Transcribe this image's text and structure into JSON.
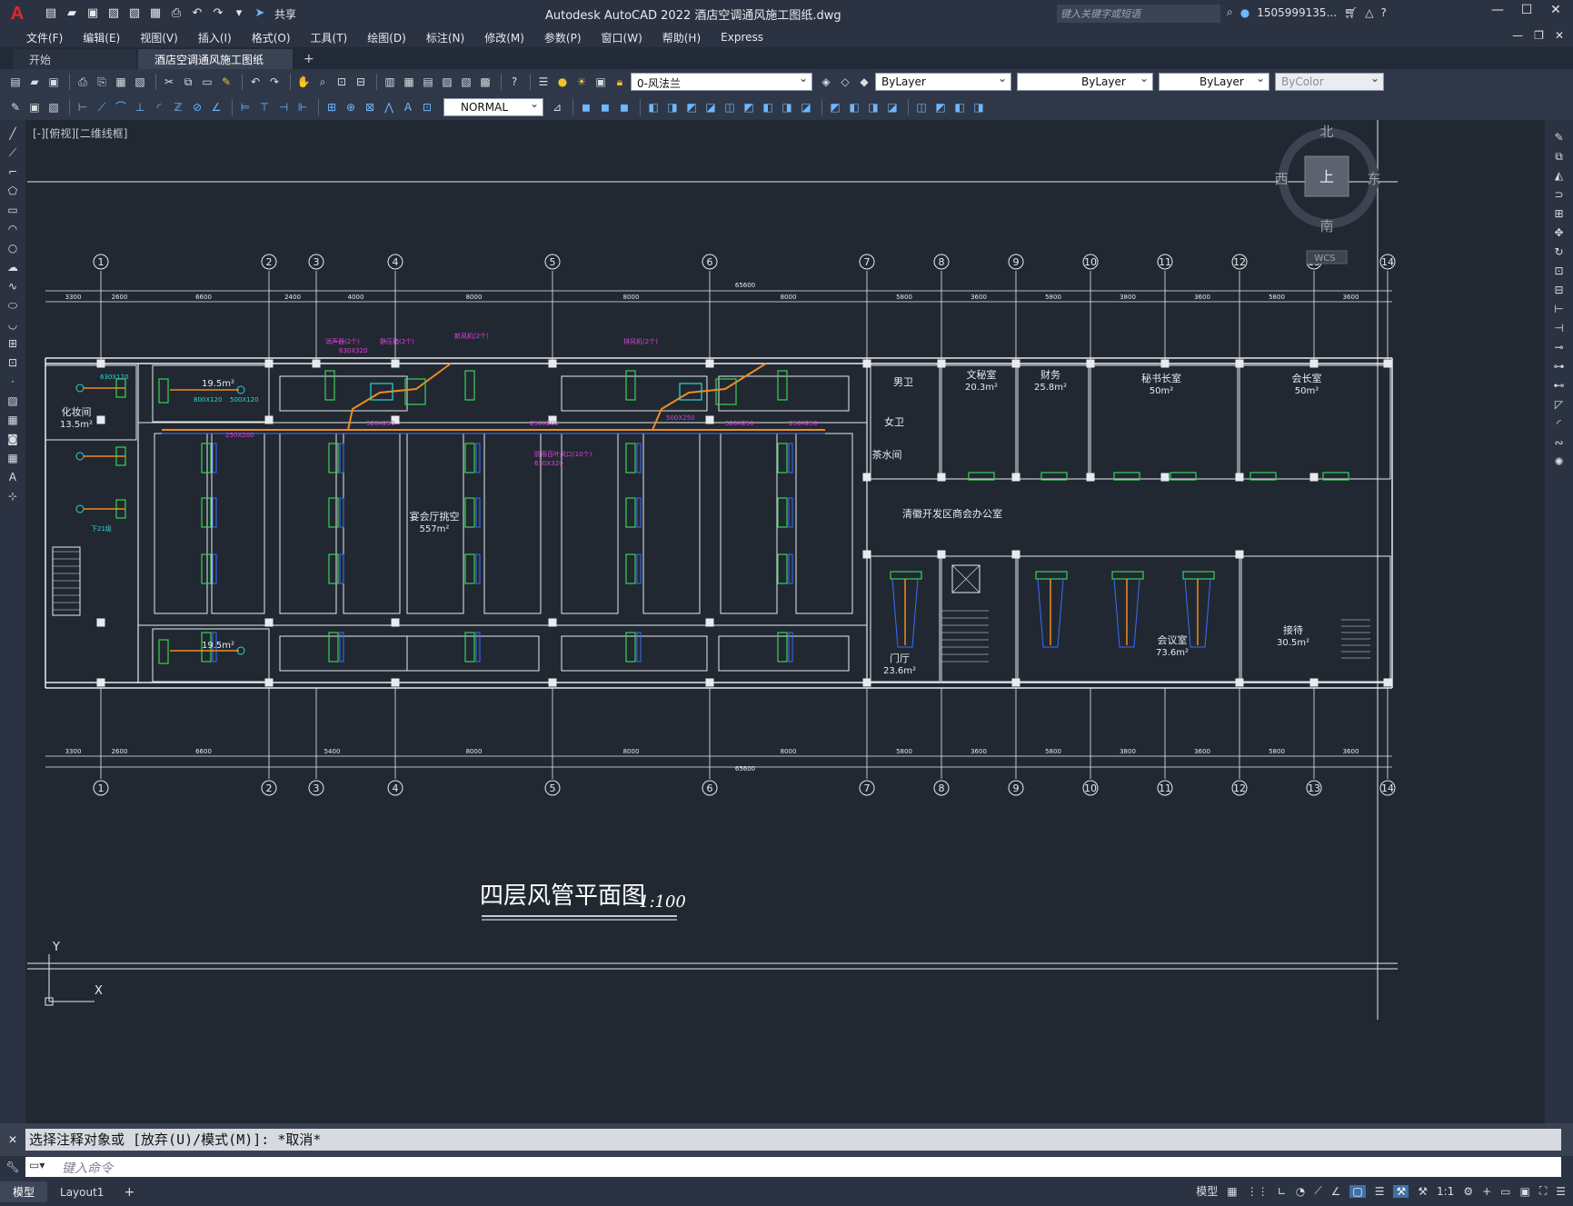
{
  "app": {
    "logo": "A",
    "title": "Autodesk AutoCAD 2022",
    "filename": "酒店空调通风施工图纸.dwg",
    "search_placeholder": "键入关键字或短语",
    "user": "1505999135...",
    "share": "共享",
    "help": "?"
  },
  "menu": [
    "文件(F)",
    "编辑(E)",
    "视图(V)",
    "插入(I)",
    "格式(O)",
    "工具(T)",
    "绘图(D)",
    "标注(N)",
    "修改(M)",
    "参数(P)",
    "窗口(W)",
    "帮助(H)",
    "Express"
  ],
  "tabs": {
    "start": "开始",
    "doc": "酒店空调通风施工图纸*",
    "close": "×",
    "add": "+"
  },
  "toolbar": {
    "layer": "0-风法兰",
    "color": "ByLayer",
    "linetype": "ByLayer",
    "lineweight": "ByLayer",
    "plotstyle": "ByColor",
    "dimstyle": "NORMAL"
  },
  "viewport": {
    "label": "[-][俯视][二维线框]",
    "compass": {
      "n": "北",
      "s": "南",
      "e": "东",
      "w": "西",
      "top": "上",
      "wcs": "WCS"
    }
  },
  "drawing": {
    "title": "四层风管平面图",
    "scale": "1:100",
    "axes_top": [
      "1",
      "2",
      "3",
      "4",
      "5",
      "6",
      "7",
      "8",
      "9",
      "10",
      "11",
      "12",
      "13",
      "14"
    ],
    "dims_top": [
      "3300",
      "2600",
      "6600",
      "2400",
      "4000",
      "8000",
      "8000",
      "8000",
      "5800",
      "3600",
      "5800",
      "3800",
      "3600",
      "5800",
      "3600"
    ],
    "total_dim": "65600",
    "dims_bottom": [
      "3300",
      "2600",
      "6600",
      "5400",
      "8000",
      "8000",
      "8000",
      "5800",
      "3600",
      "5800",
      "3800",
      "3600",
      "5800",
      "3600"
    ],
    "rooms": [
      {
        "name": "化妆间",
        "area": "13.5m²"
      },
      {
        "name": "",
        "area": "19.5m²"
      },
      {
        "name": "",
        "area": "19.5m²"
      },
      {
        "name": "宴会厅挑空",
        "area": "557m²"
      },
      {
        "name": "男卫",
        "area": ""
      },
      {
        "name": "女卫",
        "area": ""
      },
      {
        "name": "茶水间",
        "area": ""
      },
      {
        "name": "文秘室",
        "area": "20.3m²"
      },
      {
        "name": "财务",
        "area": "25.8m²"
      },
      {
        "name": "秘书长室",
        "area": "50m²"
      },
      {
        "name": "会长室",
        "area": "50m²"
      },
      {
        "name": "清徽开发区商会办公室",
        "area": ""
      },
      {
        "name": "门厅",
        "area": "23.6m²"
      },
      {
        "name": "会议室",
        "area": "73.6m²"
      },
      {
        "name": "接待",
        "area": "30.5m²"
      }
    ],
    "annotations": [
      "消声器(2个)",
      "静压箱(2个)",
      "新风机(2个)",
      "排风机(2个)",
      "630X320",
      "防雨百叶风口(10个)",
      "630X320",
      "320X250",
      "250X200",
      "250X200",
      "500X250",
      "250X250",
      "320X250",
      "630X120",
      "800X120",
      "500X120",
      "下21级"
    ],
    "axis_label_x": "X",
    "axis_label_y": "Y"
  },
  "command": {
    "history": "选择注释对象或 [放弃(U)/模式(M)]: *取消*",
    "placeholder": "键入命令"
  },
  "status": {
    "model_tab": "模型",
    "layout_tab": "Layout1",
    "add": "+",
    "model_btn": "模型",
    "scale": "1:1"
  }
}
